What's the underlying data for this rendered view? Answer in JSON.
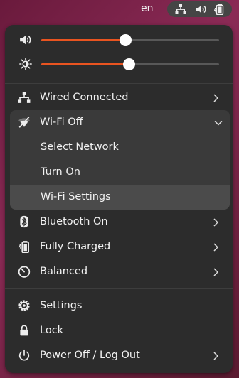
{
  "topbar": {
    "language": "en",
    "icons": [
      "network-wired-icon",
      "volume-icon",
      "battery-charging-icon"
    ]
  },
  "sliders": {
    "volume": {
      "icon": "volume-icon",
      "level": 0.47
    },
    "brightness": {
      "icon": "brightness-icon",
      "level": 0.49
    }
  },
  "menu": {
    "wired": {
      "label": "Wired Connected",
      "icon": "network-wired-icon"
    },
    "wifi": {
      "label": "Wi-Fi Off",
      "icon": "wifi-off-icon",
      "submenu": [
        "Select Network",
        "Turn On",
        "Wi-Fi Settings"
      ]
    },
    "bluetooth": {
      "label": "Bluetooth On",
      "icon": "bluetooth-icon"
    },
    "battery": {
      "label": "Fully Charged",
      "icon": "battery-charging-icon"
    },
    "power_mode": {
      "label": "Balanced",
      "icon": "power-mode-icon"
    },
    "settings": {
      "label": "Settings",
      "icon": "gear-icon"
    },
    "lock": {
      "label": "Lock",
      "icon": "lock-icon"
    },
    "power_off": {
      "label": "Power Off / Log Out",
      "icon": "power-icon"
    }
  },
  "colors": {
    "accent": "#e95420",
    "panel_bg": "#2c2c2c",
    "submenu_bg": "#3a3a3a",
    "highlight_bg": "#4b4b4b"
  }
}
